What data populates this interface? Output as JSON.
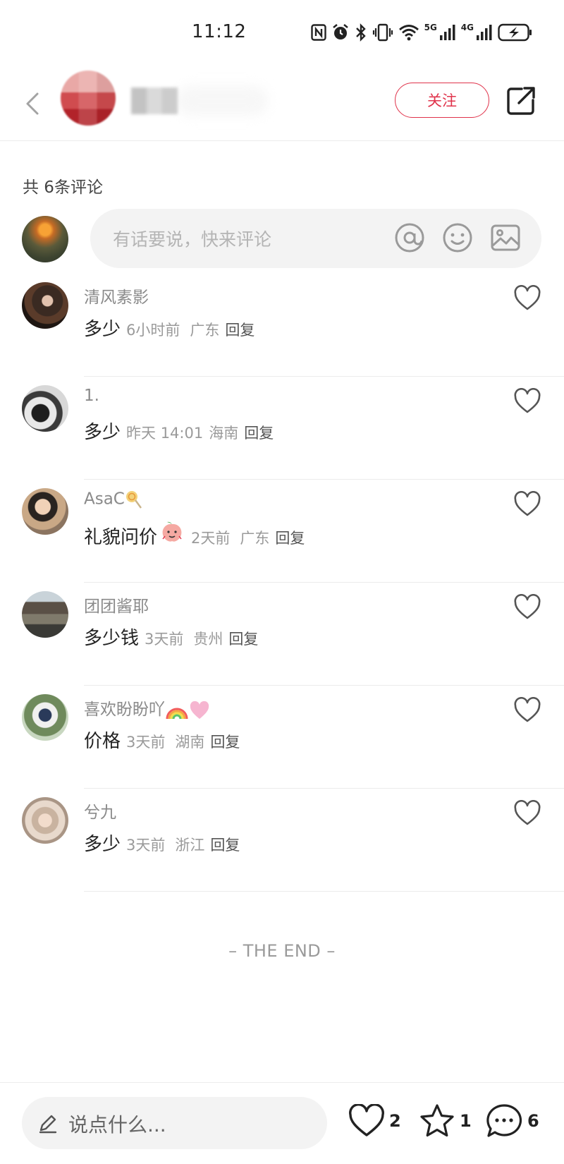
{
  "status_bar": {
    "time": "11:12",
    "signal1_label": "5G",
    "signal2_label": "4G",
    "icons": [
      "nfc-icon",
      "alarm-icon",
      "bluetooth-icon",
      "vibrate-icon",
      "wifi-icon",
      "signal-5g-icon",
      "signal-4g-icon",
      "battery-charging-icon"
    ]
  },
  "header": {
    "author_name": "",
    "follow_label": "关注"
  },
  "comments_header": {
    "count_label": "共 6条评论"
  },
  "comment_input": {
    "placeholder": "有话要说，快来评论"
  },
  "comments": [
    {
      "user": "清风素影",
      "text": "多少",
      "time": "6小时前",
      "location": "广东",
      "reply": "回复"
    },
    {
      "user": "1.",
      "text": "多少",
      "time": "昨天 14:01",
      "location": "海南",
      "reply": "回复"
    },
    {
      "user": "AsaC",
      "text": "礼貌问价",
      "time": "2天前",
      "location": "广东",
      "reply": "回复"
    },
    {
      "user": "团团酱耶",
      "text": "多少钱",
      "time": "3天前",
      "location": "贵州",
      "reply": "回复"
    },
    {
      "user": "喜欢盼盼吖",
      "text": "价格",
      "time": "3天前",
      "location": "湖南",
      "reply": "回复"
    },
    {
      "user": "兮九",
      "text": "多少",
      "time": "3天前",
      "location": "浙江",
      "reply": "回复"
    }
  ],
  "footer": {
    "end_label": "– THE END –"
  },
  "bottom_bar": {
    "input_placeholder": "说点什么...",
    "likes": "2",
    "favorites": "1",
    "comments": "6"
  },
  "colors": {
    "accent": "#e0334b",
    "divider": "#ebebeb",
    "input_bg": "#f3f3f3"
  }
}
